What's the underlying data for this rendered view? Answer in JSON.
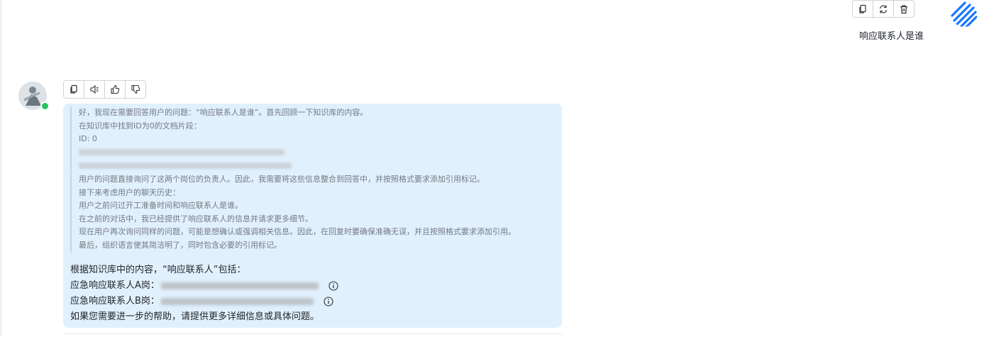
{
  "user": {
    "message": "响应联系人是谁",
    "toolbar": {
      "icons": [
        "copy-icon",
        "refresh-icon",
        "trash-icon"
      ]
    }
  },
  "bot": {
    "toolbar": {
      "icons": [
        "copy-icon",
        "speaker-icon",
        "thumbs-up-icon",
        "thumbs-down-icon"
      ]
    },
    "thinking_block_1": [
      "好，我现在需要回答用户的问题：“响应联系人是谁”。首先回顾一下知识库的内容。",
      "在知识库中找到ID为0的文档片段：",
      "ID: 0"
    ],
    "thinking_block_2": [
      "用户的问题直接询问了这两个岗位的负责人。因此，我需要将这些信息整合到回答中，并按照格式要求添加引用标记。",
      "接下来考虑用户的聊天历史：",
      "用户之前问过开工准备时间和响应联系人是谁。",
      "在之前的对话中，我已经提供了响应联系人的信息并请求更多细节。",
      "现在用户再次询问同样的问题，可能是想确认或强调相关信息。因此，在回复时要确保准确无误，并且按照格式要求添加引用。",
      "最后，组织语言使其简洁明了，同时包含必要的引用标记。"
    ],
    "answer": {
      "intro": "根据知识库中的内容，“响应联系人”包括：",
      "line_a_label": "应急响应联系人A岗：",
      "line_b_label": "应急响应联系人B岗：",
      "closing": "如果您需要进一步的帮助，请提供更多详细信息或具体问题。"
    }
  },
  "colors": {
    "bubble_bg": "#e1f0fd",
    "online": "#22c55e",
    "brand_stripe": "#1677ff"
  }
}
